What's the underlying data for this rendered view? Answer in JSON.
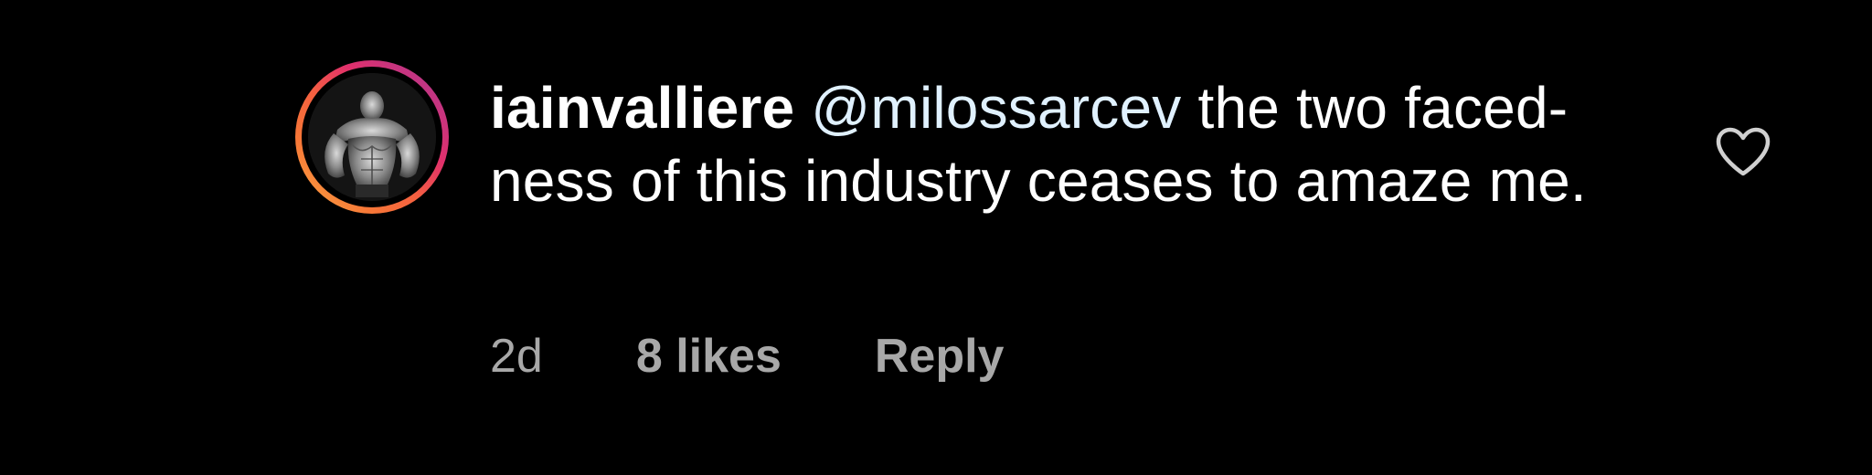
{
  "comment": {
    "username": "iainvalliere",
    "mention": "@milossarcev",
    "text": " the two faced-ness of this industry ceases to amaze me.",
    "time": "2d",
    "likes": "8 likes",
    "reply_label": "Reply",
    "like_icon": "heart-outline-icon",
    "avatar_ring_colors": [
      "#fcaf45",
      "#f77737",
      "#e1306c",
      "#c13584",
      "#833ab4"
    ],
    "mention_color": "#e0f1ff",
    "meta_color": "#a8a8a8",
    "background": "#000000"
  }
}
